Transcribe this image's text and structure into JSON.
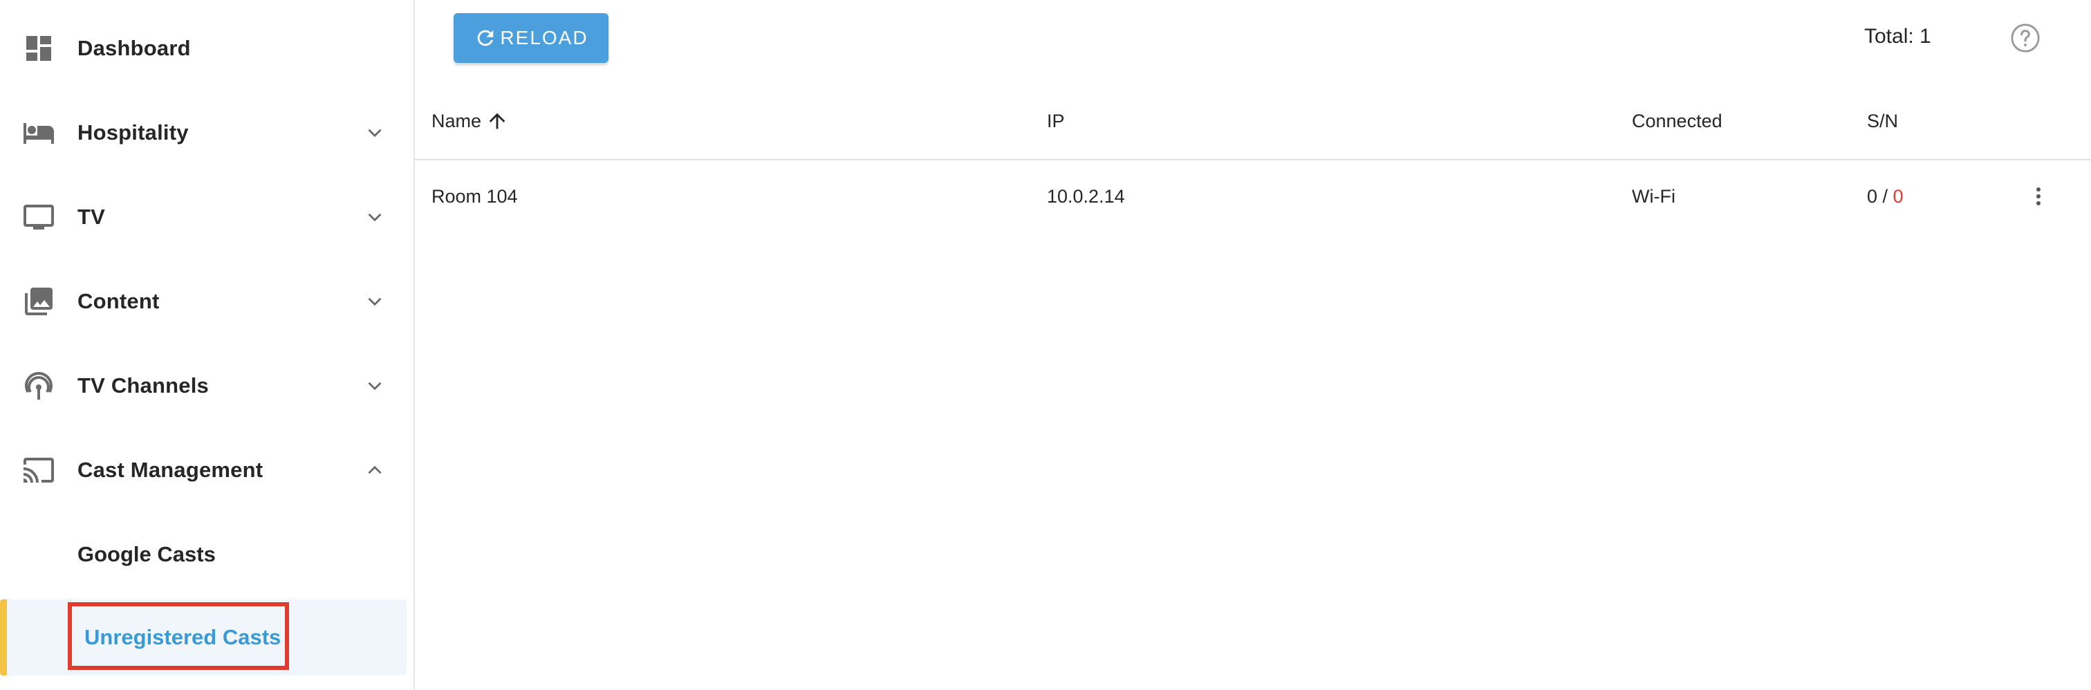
{
  "sidebar": {
    "items": [
      {
        "label": "Dashboard",
        "icon": "dashboard-icon"
      },
      {
        "label": "Hospitality",
        "icon": "hotel-bed-icon"
      },
      {
        "label": "TV",
        "icon": "tv-icon"
      },
      {
        "label": "Content",
        "icon": "photo-library-icon"
      },
      {
        "label": "TV Channels",
        "icon": "broadcast-antenna-icon"
      },
      {
        "label": "Cast Management",
        "icon": "cast-icon"
      }
    ],
    "sub_items": [
      {
        "label": "Google Casts"
      },
      {
        "label": "Unregistered Casts"
      }
    ],
    "active_accent": "#f5c344",
    "active_text_color": "#3a9ad5",
    "highlight_color": "#e03c2d"
  },
  "toolbar": {
    "reload_label": "RELOAD",
    "total_text": "Total: 1",
    "button_color": "#4a9fdc"
  },
  "table": {
    "columns": [
      "Name",
      "IP",
      "Connected",
      "S/N"
    ],
    "sort_column": "Name",
    "sort_direction": "ascending",
    "rows": [
      {
        "name": "Room 104",
        "ip": "10.0.2.14",
        "connected": "Wi-Fi",
        "sn_left": "0",
        "sn_sep": " / ",
        "sn_right": "0"
      }
    ]
  }
}
